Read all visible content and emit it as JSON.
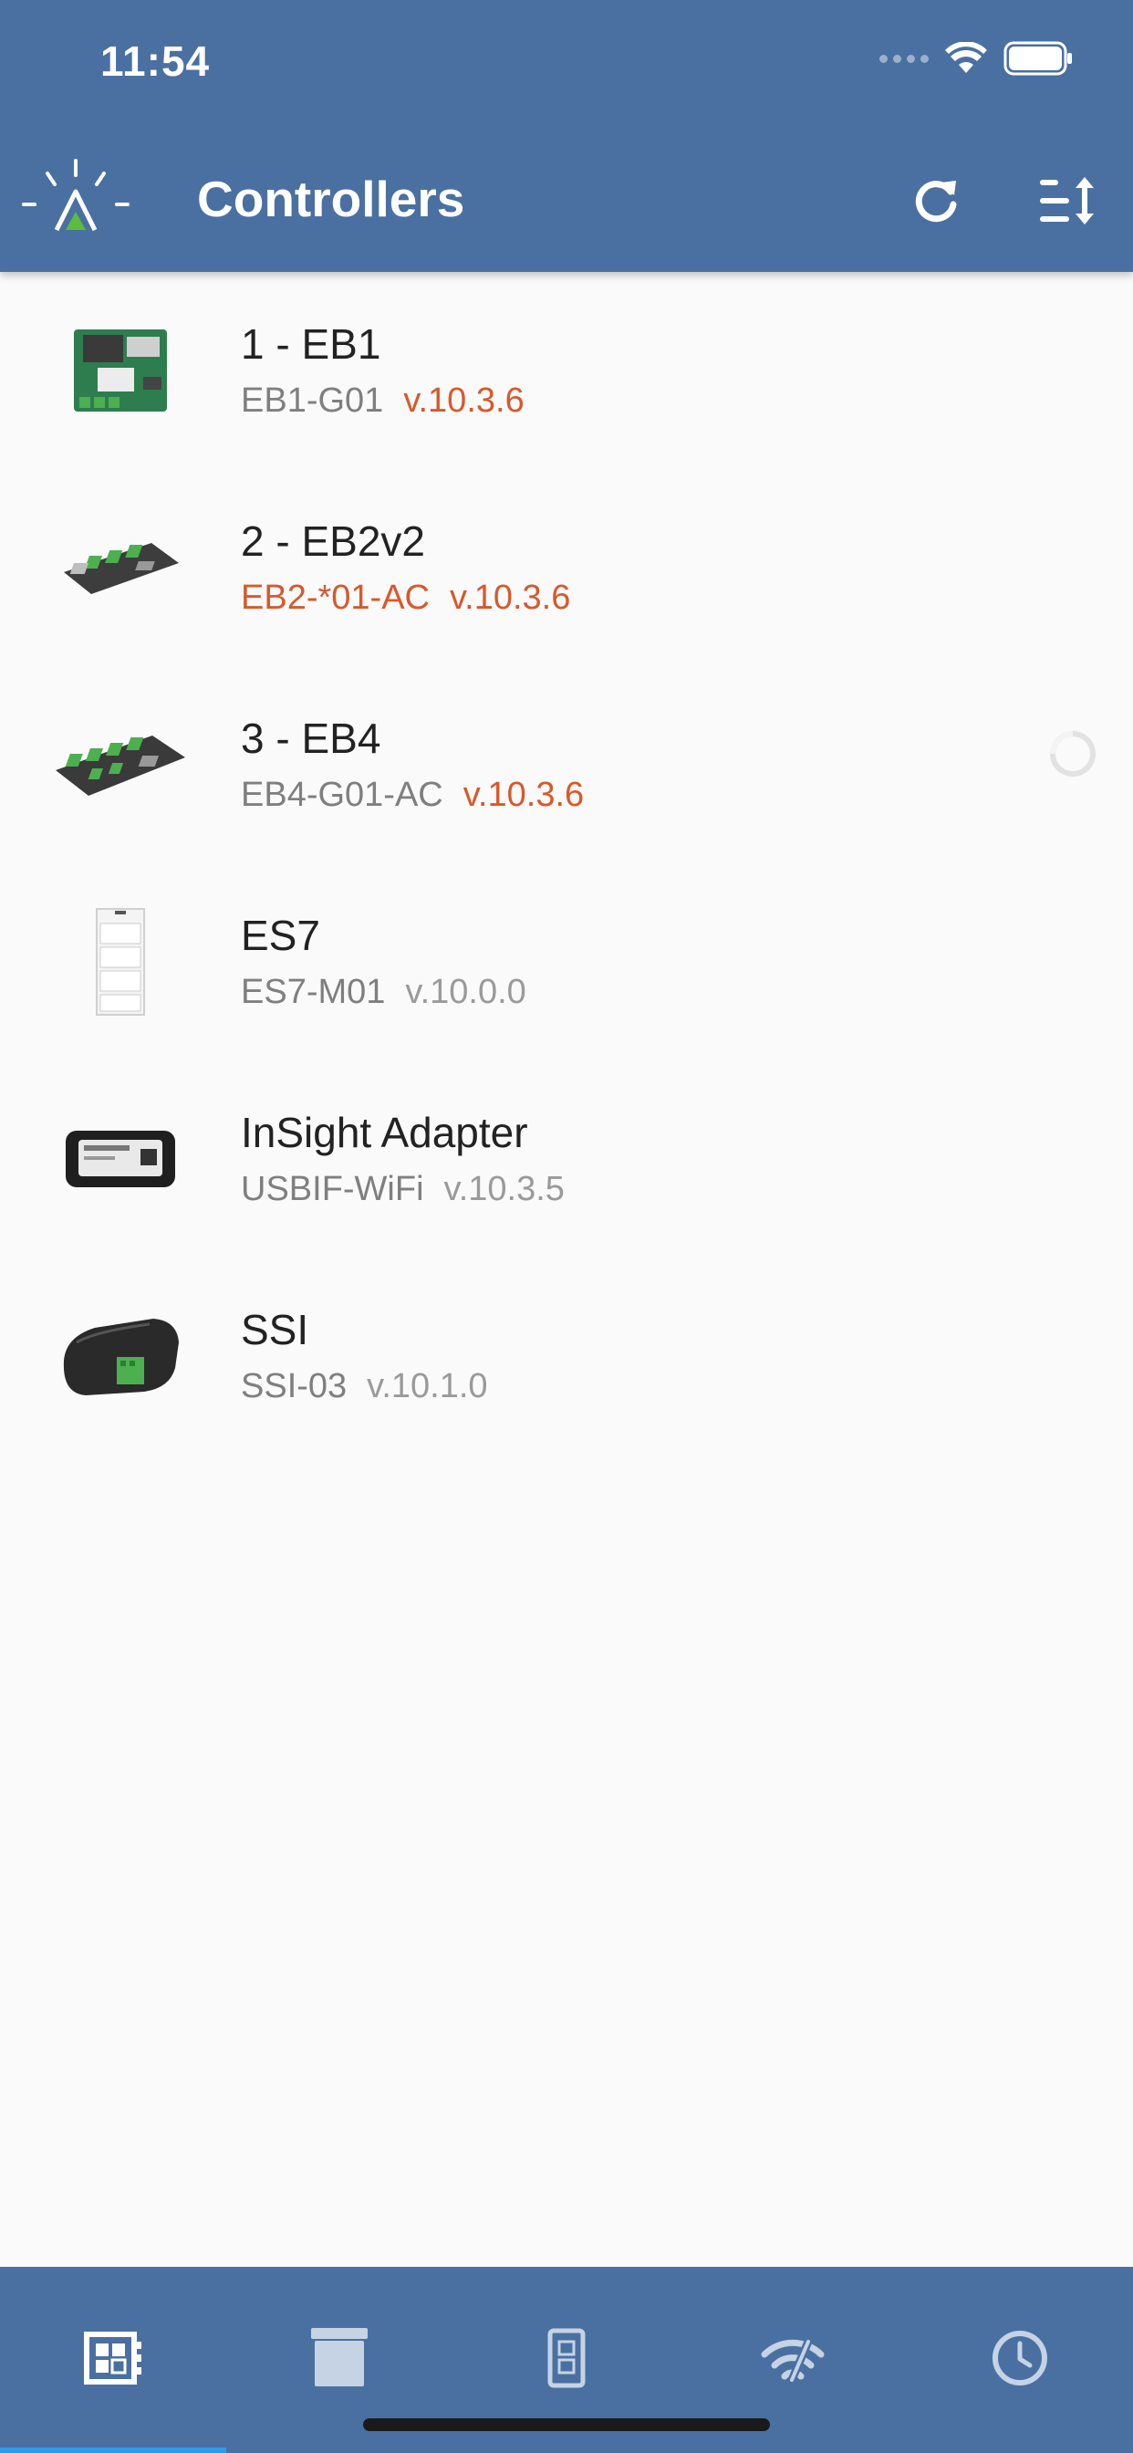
{
  "status": {
    "time": "11:54"
  },
  "header": {
    "title": "Controllers",
    "refresh_icon": "refresh-icon",
    "sort_icon": "sort-icon"
  },
  "colors": {
    "header_bg": "#4a70a2",
    "accent_orange": "#d9582b",
    "logo_green": "#5dbb3f",
    "tab_active_indicator": "#2f9ae8"
  },
  "controllers": [
    {
      "name": "1 - EB1",
      "model": "EB1-G01",
      "version": "v.10.3.6",
      "model_warning": false,
      "version_warning": true,
      "image": "eb1-board-image",
      "loading": false
    },
    {
      "name": "2 - EB2v2",
      "model": "EB2-*01-AC",
      "version": "v.10.3.6",
      "model_warning": true,
      "version_warning": true,
      "image": "eb2-board-image",
      "loading": false
    },
    {
      "name": "3 - EB4",
      "model": "EB4-G01-AC",
      "version": "v.10.3.6",
      "model_warning": false,
      "version_warning": true,
      "image": "eb4-board-image",
      "loading": true
    },
    {
      "name": "ES7",
      "model": "ES7-M01",
      "version": "v.10.0.0",
      "model_warning": false,
      "version_warning": false,
      "image": "es7-keypad-image",
      "loading": false
    },
    {
      "name": "InSight Adapter",
      "model": "USBIF-WiFi",
      "version": "v.10.3.5",
      "model_warning": false,
      "version_warning": false,
      "image": "insight-adapter-image",
      "loading": false
    },
    {
      "name": "SSI",
      "model": "SSI-03",
      "version": "v.10.1.0",
      "model_warning": false,
      "version_warning": false,
      "image": "ssi-module-image",
      "loading": false
    }
  ],
  "tabs": [
    {
      "icon": "controllers-tab-icon",
      "active": true
    },
    {
      "icon": "archive-tab-icon",
      "active": false
    },
    {
      "icon": "device-tab-icon",
      "active": false
    },
    {
      "icon": "network-tab-icon",
      "active": false
    },
    {
      "icon": "clock-tab-icon",
      "active": false
    }
  ]
}
